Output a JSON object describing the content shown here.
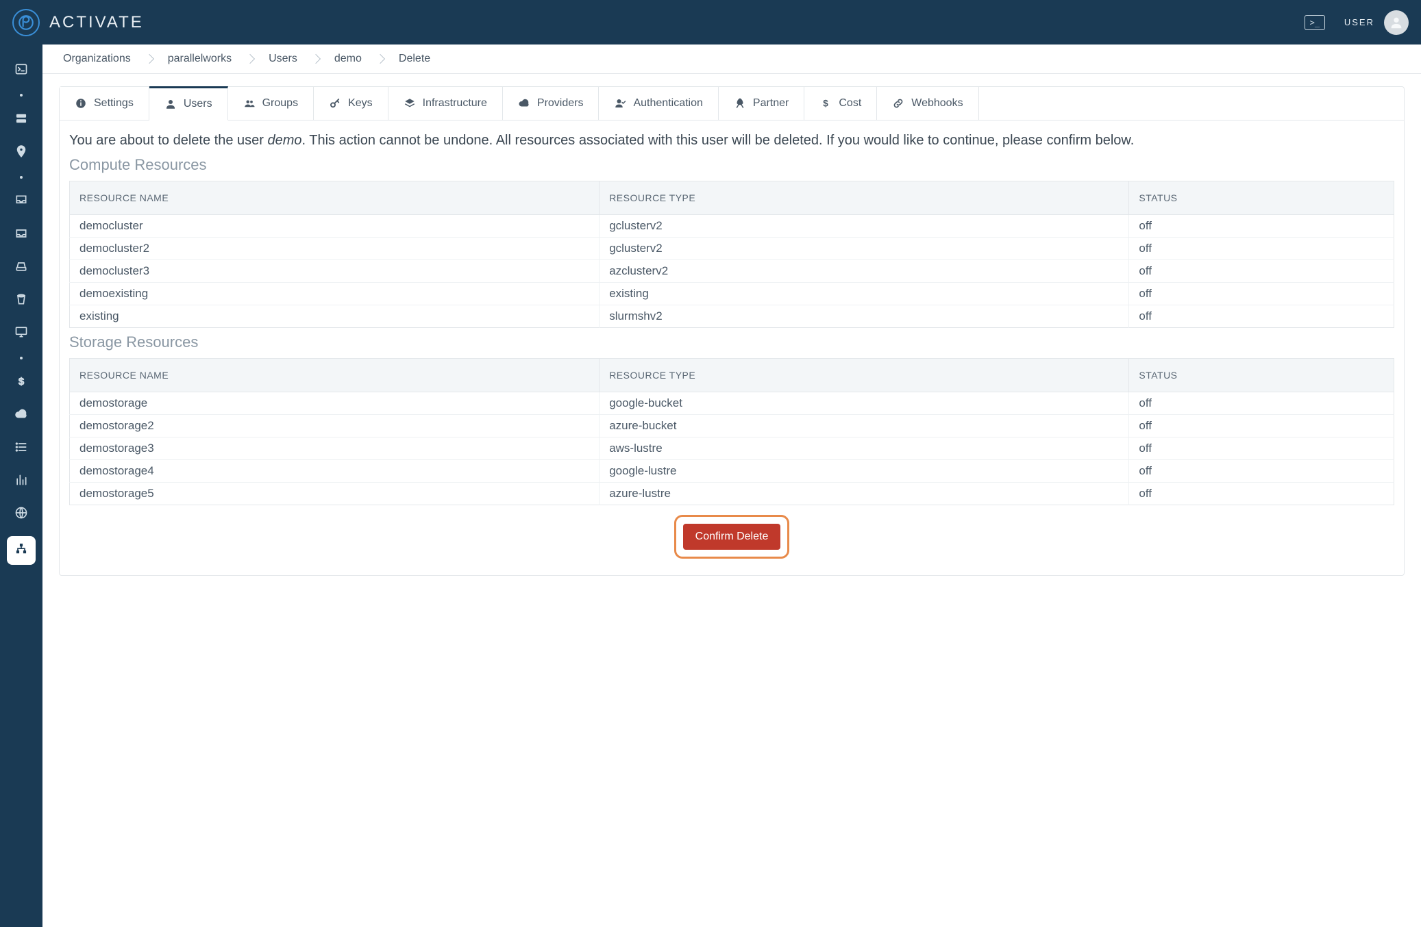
{
  "brand": "ACTIVATE",
  "topbar": {
    "user_label": "USER",
    "terminal_glyph": ">_"
  },
  "breadcrumb": [
    {
      "label": "Organizations"
    },
    {
      "label": "parallelworks"
    },
    {
      "label": "Users"
    },
    {
      "label": "demo"
    },
    {
      "label": "Delete"
    }
  ],
  "tabs": [
    {
      "icon": "info",
      "label": "Settings",
      "active": false
    },
    {
      "icon": "user",
      "label": "Users",
      "active": true
    },
    {
      "icon": "group",
      "label": "Groups",
      "active": false
    },
    {
      "icon": "key",
      "label": "Keys",
      "active": false
    },
    {
      "icon": "layers",
      "label": "Infrastructure",
      "active": false
    },
    {
      "icon": "cloud",
      "label": "Providers",
      "active": false
    },
    {
      "icon": "usercheck",
      "label": "Authentication",
      "active": false
    },
    {
      "icon": "rocket",
      "label": "Partner",
      "active": false
    },
    {
      "icon": "dollar",
      "label": "Cost",
      "active": false
    },
    {
      "icon": "link",
      "label": "Webhooks",
      "active": false
    }
  ],
  "warning": {
    "pre": "You are about to delete the user ",
    "user": "demo",
    "post": ". This action cannot be undone. All resources associated with this user will be deleted. If you would like to continue, please confirm below."
  },
  "sections": {
    "compute": {
      "heading": "Compute Resources",
      "columns": [
        "RESOURCE NAME",
        "RESOURCE TYPE",
        "STATUS"
      ],
      "rows": [
        {
          "name": "democluster",
          "type": "gclusterv2",
          "status": "off"
        },
        {
          "name": "democluster2",
          "type": "gclusterv2",
          "status": "off"
        },
        {
          "name": "democluster3",
          "type": "azclusterv2",
          "status": "off"
        },
        {
          "name": "demoexisting",
          "type": "existing",
          "status": "off"
        },
        {
          "name": "existing",
          "type": "slurmshv2",
          "status": "off"
        }
      ]
    },
    "storage": {
      "heading": "Storage Resources",
      "columns": [
        "RESOURCE NAME",
        "RESOURCE TYPE",
        "STATUS"
      ],
      "rows": [
        {
          "name": "demostorage",
          "type": "google-bucket",
          "status": "off"
        },
        {
          "name": "demostorage2",
          "type": "azure-bucket",
          "status": "off"
        },
        {
          "name": "demostorage3",
          "type": "aws-lustre",
          "status": "off"
        },
        {
          "name": "demostorage4",
          "type": "google-lustre",
          "status": "off"
        },
        {
          "name": "demostorage5",
          "type": "azure-lustre",
          "status": "off"
        }
      ]
    }
  },
  "confirm_label": "Confirm Delete",
  "sidebar_icons": [
    "terminal",
    "dot",
    "server",
    "pin",
    "dot",
    "inbox",
    "inbox2",
    "drive",
    "bucket",
    "monitor",
    "dot",
    "dollar",
    "cloud",
    "list",
    "barchart",
    "globe",
    "org"
  ]
}
